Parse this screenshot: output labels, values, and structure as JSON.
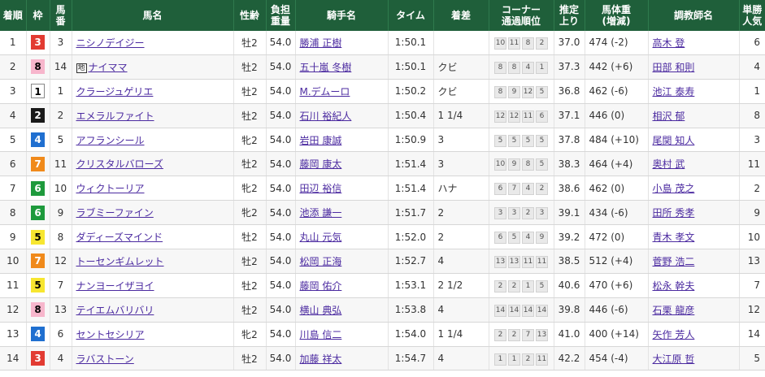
{
  "headers": {
    "rank": "着順",
    "waku": "枠",
    "umaban_1": "馬",
    "umaban_2": "番",
    "horse": "馬名",
    "sexage": "性齢",
    "weight_1": "負担",
    "weight_2": "重量",
    "jockey": "騎手名",
    "time": "タイム",
    "margin": "着差",
    "corner_1": "コーナー",
    "corner_2": "通過順位",
    "last_1": "推定",
    "last_2": "上り",
    "body_1": "馬体重",
    "body_2": "(増減)",
    "trainer": "調教師名",
    "pop_1": "単勝",
    "pop_2": "人気"
  },
  "rows": [
    {
      "rank": "1",
      "waku": "3",
      "umaban": "3",
      "horse": "ニシノデイジー",
      "chihou": "",
      "sexage": "牡2",
      "weight": "54.0",
      "jockey": "勝浦 正樹",
      "time": "1:50.1",
      "margin": "",
      "corner": [
        "10",
        "11",
        "8",
        "2"
      ],
      "last": "37.0",
      "body": "474 (-2)",
      "trainer": "高木 登",
      "pop": "6"
    },
    {
      "rank": "2",
      "waku": "8",
      "umaban": "14",
      "horse": "ナイママ",
      "chihou": "地",
      "sexage": "牡2",
      "weight": "54.0",
      "jockey": "五十嵐 冬樹",
      "time": "1:50.1",
      "margin": "クビ",
      "corner": [
        "8",
        "8",
        "4",
        "1"
      ],
      "last": "37.3",
      "body": "442 (+6)",
      "trainer": "田部 和則",
      "pop": "4"
    },
    {
      "rank": "3",
      "waku": "1",
      "umaban": "1",
      "horse": "クラージュゲリエ",
      "chihou": "",
      "sexage": "牡2",
      "weight": "54.0",
      "jockey": "M.デムーロ",
      "time": "1:50.2",
      "margin": "クビ",
      "corner": [
        "8",
        "9",
        "12",
        "5"
      ],
      "last": "36.8",
      "body": "462 (-6)",
      "trainer": "池江 泰寿",
      "pop": "1"
    },
    {
      "rank": "4",
      "waku": "2",
      "umaban": "2",
      "horse": "エメラルファイト",
      "chihou": "",
      "sexage": "牡2",
      "weight": "54.0",
      "jockey": "石川 裕紀人",
      "time": "1:50.4",
      "margin": "1 1/4",
      "corner": [
        "12",
        "12",
        "11",
        "6"
      ],
      "last": "37.1",
      "body": "446 (0)",
      "trainer": "相沢 郁",
      "pop": "8"
    },
    {
      "rank": "5",
      "waku": "4",
      "umaban": "5",
      "horse": "アフランシール",
      "chihou": "",
      "sexage": "牝2",
      "weight": "54.0",
      "jockey": "岩田 康誠",
      "time": "1:50.9",
      "margin": "3",
      "corner": [
        "5",
        "5",
        "5",
        "5"
      ],
      "last": "37.8",
      "body": "484 (+10)",
      "trainer": "尾関 知人",
      "pop": "3"
    },
    {
      "rank": "6",
      "waku": "7",
      "umaban": "11",
      "horse": "クリスタルバローズ",
      "chihou": "",
      "sexage": "牡2",
      "weight": "54.0",
      "jockey": "藤岡 康太",
      "time": "1:51.4",
      "margin": "3",
      "corner": [
        "10",
        "9",
        "8",
        "5"
      ],
      "last": "38.3",
      "body": "464 (+4)",
      "trainer": "奥村 武",
      "pop": "11"
    },
    {
      "rank": "7",
      "waku": "6",
      "umaban": "10",
      "horse": "ウィクトーリア",
      "chihou": "",
      "sexage": "牝2",
      "weight": "54.0",
      "jockey": "田辺 裕信",
      "time": "1:51.4",
      "margin": "ハナ",
      "corner": [
        "6",
        "7",
        "4",
        "2"
      ],
      "last": "38.6",
      "body": "462 (0)",
      "trainer": "小島 茂之",
      "pop": "2"
    },
    {
      "rank": "8",
      "waku": "6",
      "umaban": "9",
      "horse": "ラブミーファイン",
      "chihou": "",
      "sexage": "牝2",
      "weight": "54.0",
      "jockey": "池添 謙一",
      "time": "1:51.7",
      "margin": "2",
      "corner": [
        "3",
        "3",
        "2",
        "3"
      ],
      "last": "39.1",
      "body": "434 (-6)",
      "trainer": "田所 秀孝",
      "pop": "9"
    },
    {
      "rank": "9",
      "waku": "5",
      "umaban": "8",
      "horse": "ダディーズマインド",
      "chihou": "",
      "sexage": "牡2",
      "weight": "54.0",
      "jockey": "丸山 元気",
      "time": "1:52.0",
      "margin": "2",
      "corner": [
        "6",
        "5",
        "4",
        "9"
      ],
      "last": "39.2",
      "body": "472 (0)",
      "trainer": "青木 孝文",
      "pop": "10"
    },
    {
      "rank": "10",
      "waku": "7",
      "umaban": "12",
      "horse": "トーセンギムレット",
      "chihou": "",
      "sexage": "牡2",
      "weight": "54.0",
      "jockey": "松岡 正海",
      "time": "1:52.7",
      "margin": "4",
      "corner": [
        "13",
        "13",
        "11",
        "11"
      ],
      "last": "38.5",
      "body": "512 (+4)",
      "trainer": "菅野 浩二",
      "pop": "13"
    },
    {
      "rank": "11",
      "waku": "5",
      "umaban": "7",
      "horse": "ナンヨーイザヨイ",
      "chihou": "",
      "sexage": "牡2",
      "weight": "54.0",
      "jockey": "藤岡 佑介",
      "time": "1:53.1",
      "margin": "2 1/2",
      "corner": [
        "2",
        "2",
        "1",
        "5"
      ],
      "last": "40.6",
      "body": "470 (+6)",
      "trainer": "松永 幹夫",
      "pop": "7"
    },
    {
      "rank": "12",
      "waku": "8",
      "umaban": "13",
      "horse": "テイエムバリバリ",
      "chihou": "",
      "sexage": "牡2",
      "weight": "54.0",
      "jockey": "横山 典弘",
      "time": "1:53.8",
      "margin": "4",
      "corner": [
        "14",
        "14",
        "14",
        "14"
      ],
      "last": "39.8",
      "body": "446 (-6)",
      "trainer": "石栗 龍彦",
      "pop": "12"
    },
    {
      "rank": "13",
      "waku": "4",
      "umaban": "6",
      "horse": "セントセシリア",
      "chihou": "",
      "sexage": "牝2",
      "weight": "54.0",
      "jockey": "川島 信二",
      "time": "1:54.0",
      "margin": "1 1/4",
      "corner": [
        "2",
        "2",
        "7",
        "13"
      ],
      "last": "41.0",
      "body": "400 (+14)",
      "trainer": "矢作 芳人",
      "pop": "14"
    },
    {
      "rank": "14",
      "waku": "3",
      "umaban": "4",
      "horse": "ラバストーン",
      "chihou": "",
      "sexage": "牡2",
      "weight": "54.0",
      "jockey": "加藤 祥太",
      "time": "1:54.7",
      "margin": "4",
      "corner": [
        "1",
        "1",
        "2",
        "11"
      ],
      "last": "42.2",
      "body": "454 (-4)",
      "trainer": "大江原 哲",
      "pop": "5"
    }
  ]
}
